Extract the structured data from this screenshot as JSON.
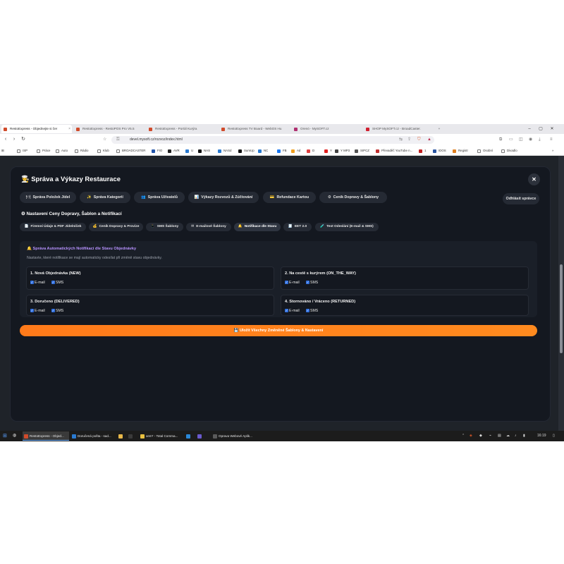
{
  "browser": {
    "tabs": [
      {
        "label": "RestoExpress - Objednejte si čer",
        "active": true,
        "favicon_color": "#d04b2b"
      },
      {
        "label": "RestoExpress - RestoPOS Pro V5.5",
        "active": false,
        "favicon_color": "#d04b2b"
      },
      {
        "label": "RestoExpress - Portál Kurýra",
        "active": false,
        "favicon_color": "#d04b2b"
      },
      {
        "label": "RestoExpress TV Board - WebOS Hu",
        "active": false,
        "favicon_color": "#d04b2b"
      },
      {
        "label": "Orenö - MySOFT.cz",
        "active": false,
        "favicon_color": "#b03070"
      },
      {
        "label": "SHOP MySOFT.cz - BroadCaster.",
        "active": false,
        "favicon_color": "#d02030"
      }
    ],
    "new_tab": "+",
    "nav": {
      "back": "‹",
      "forward": "›",
      "reload": "↻"
    },
    "url": "devel.mysoft.cz/rozvoz/index.html",
    "bookmarks": [
      {
        "label": "ISP",
        "icon": "folder-icon",
        "color": "#777777"
      },
      {
        "label": "Práce",
        "icon": "folder-icon",
        "color": "#777777"
      },
      {
        "label": "Auto",
        "icon": "folder-icon",
        "color": "#777777"
      },
      {
        "label": "Rádio",
        "icon": "folder-icon",
        "color": "#777777"
      },
      {
        "label": "Klub",
        "icon": "folder-icon",
        "color": "#777777"
      },
      {
        "label": "BROADCASTER",
        "icon": "folder-icon",
        "color": "#777777"
      },
      {
        "label": "FIO",
        "icon": "site-icon",
        "color": "#2255aa"
      },
      {
        "label": "AVR",
        "icon": "site-icon",
        "color": "#222222"
      },
      {
        "label": "U",
        "icon": "site-icon",
        "color": "#2a7ad0"
      },
      {
        "label": "NAS",
        "icon": "site-icon",
        "color": "#111111"
      },
      {
        "label": "NASd",
        "icon": "site-icon",
        "color": "#2a7ad0"
      },
      {
        "label": "SumUp",
        "icon": "site-icon",
        "color": "#111111"
      },
      {
        "label": "NC",
        "icon": "site-icon",
        "color": "#2a7ad0"
      },
      {
        "label": "FB",
        "icon": "site-icon",
        "color": "#1877f2"
      },
      {
        "label": "Ad",
        "icon": "site-icon",
        "color": "#f0a020"
      },
      {
        "label": "D",
        "icon": "site-icon",
        "color": "#e04040"
      },
      {
        "label": "Y",
        "icon": "site-icon",
        "color": "#e02020"
      },
      {
        "label": "Y MP3",
        "icon": "site-icon",
        "color": "#444444"
      },
      {
        "label": "SIPCZ",
        "icon": "site-icon",
        "color": "#555555"
      },
      {
        "label": "Převaděč YouTube n...",
        "icon": "site-icon",
        "color": "#c03030"
      },
      {
        "label": "1",
        "icon": "site-icon",
        "color": "#c02020"
      },
      {
        "label": "IDOS",
        "icon": "site-icon",
        "color": "#2a55a0"
      },
      {
        "label": "Registr",
        "icon": "site-icon",
        "color": "#e08020"
      },
      {
        "label": "Osobní",
        "icon": "folder-icon",
        "color": "#777777"
      },
      {
        "label": "Divadlo",
        "icon": "folder-icon",
        "color": "#777777"
      }
    ]
  },
  "modal": {
    "title_icon": "👨‍🍳",
    "title": "Správa a Výkazy Restaurace",
    "close": "✕",
    "main_tabs": [
      {
        "icon": "🍽",
        "label": "Správa Položek Jídel"
      },
      {
        "icon": "✨",
        "label": "Správa Kategorií"
      },
      {
        "icon": "👥",
        "label": "Správa Uživatelů"
      },
      {
        "icon": "📊",
        "label": "Výkazy Rozvozů & Zúčtování"
      },
      {
        "icon": "💳",
        "label": "Refundace Kartou"
      },
      {
        "icon": "⚙",
        "label": "Ceník Dopravy & Šablony"
      }
    ],
    "logout": "Odhlásit správce",
    "section_icon": "⚙",
    "section_title": "Nastavení Ceny Dopravy, Šablon a Notifikací",
    "sub_tabs": [
      {
        "icon": "📄",
        "label": "Firemní Údaje & PDF Jídelníček"
      },
      {
        "icon": "💰",
        "label": "Ceník Dopravy & Provize"
      },
      {
        "icon": "📱",
        "label": "SMS Šablony"
      },
      {
        "icon": "✉",
        "label": "E-mailové Šablony"
      },
      {
        "icon": "🔔",
        "label": "Notifikace dle Stavu"
      },
      {
        "icon": "🧾",
        "label": "EET 2.0"
      },
      {
        "icon": "🧪",
        "label": "Test Odeslání (E-mail & SMS)"
      }
    ],
    "panel": {
      "title_icon": "🔔",
      "title": "Správa Automatických Notifikací dle Stavu Objednávky",
      "description": "Nastavte, které notifikace se mají automaticky odesílat při změně stavu objednávky.",
      "statuses": [
        {
          "title": "1. Nová Objednávka (NEW)",
          "email_label": "E-mail",
          "sms_label": "SMS",
          "email": true,
          "sms": true
        },
        {
          "title": "2. Na cestě s kurýrem (ON_THE_WAY)",
          "email_label": "E-mail",
          "sms_label": "SMS",
          "email": true,
          "sms": true
        },
        {
          "title": "3. Doručeno (DELIVERED)",
          "email_label": "E-mail",
          "sms_label": "SMS",
          "email": true,
          "sms": true
        },
        {
          "title": "4. Stornováno / Vráceno (RETURNED)",
          "email_label": "E-mail",
          "sms_label": "SMS",
          "email": true,
          "sms": true
        }
      ]
    },
    "save_icon": "💾",
    "save_label": "Uložit Všechny Změněné Šablony & Nastavení"
  },
  "taskbar": {
    "apps": [
      {
        "label": "RestoExpress - Objed...",
        "active": true,
        "color": "#d04b2b"
      },
      {
        "label": "Doručená pošta - sad...",
        "active": false,
        "color": "#2a7ad0"
      },
      {
        "label": "",
        "active": false,
        "color": "#e8b84a"
      },
      {
        "label": "",
        "active": false,
        "color": "#3a3a3a"
      },
      {
        "label": "xem* - Total Comma...",
        "active": false,
        "color": "#e8c040"
      },
      {
        "label": "",
        "active": false,
        "color": "#2a88d8"
      },
      {
        "label": "",
        "active": false,
        "color": "#6a5acd"
      },
      {
        "label": "Oprava Webové Aplik...",
        "active": false,
        "color": "#5a5a5a"
      }
    ],
    "clock": "16:19",
    "tray_icons": [
      "network-icon",
      "volume-icon",
      "battery-icon"
    ]
  },
  "colors": {
    "accent_orange": "#ff7a1a",
    "accent_purple": "#b792ff",
    "checkbox_blue": "#2f6fe0",
    "modal_bg": "#141820"
  }
}
